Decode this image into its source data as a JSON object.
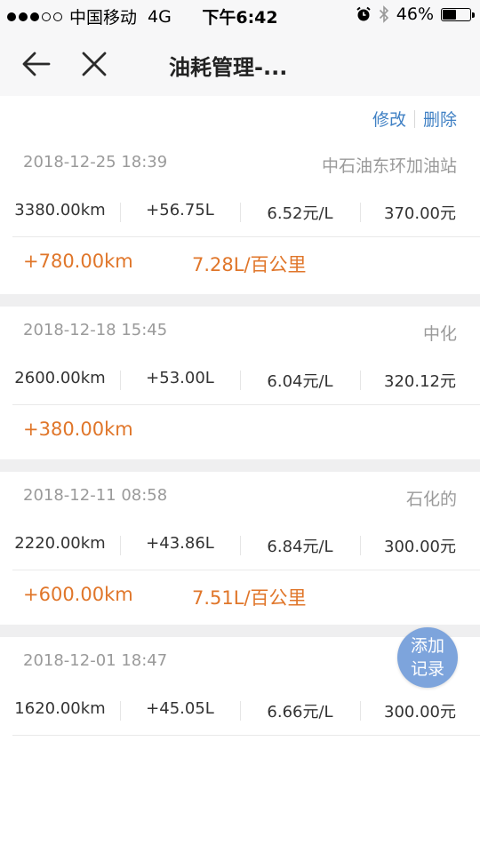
{
  "status": {
    "carrier": "中国移动",
    "network": "4G",
    "time": "下午6:42",
    "battery": "46%",
    "alarm_icon": "alarm-clock-icon",
    "bluetooth_icon": "bluetooth-icon"
  },
  "nav": {
    "title": "油耗管理-...",
    "back_icon": "back-arrow-icon",
    "close_icon": "close-icon"
  },
  "actions": {
    "edit": "修改",
    "delete": "删除"
  },
  "records": [
    {
      "datetime": "2018-12-25 18:39",
      "station": "中石油东环加油站",
      "odometer": "3380.00km",
      "fuel": "+56.75L",
      "price": "6.52元/L",
      "amount": "370.00元",
      "distance": "+780.00km",
      "consumption": "7.28L/百公里"
    },
    {
      "datetime": "2018-12-18 15:45",
      "station": "中化",
      "odometer": "2600.00km",
      "fuel": "+53.00L",
      "price": "6.04元/L",
      "amount": "320.12元",
      "distance": "+380.00km",
      "consumption": ""
    },
    {
      "datetime": "2018-12-11 08:58",
      "station": "石化的",
      "odometer": "2220.00km",
      "fuel": "+43.86L",
      "price": "6.84元/L",
      "amount": "300.00元",
      "distance": "+600.00km",
      "consumption": "7.51L/百公里"
    },
    {
      "datetime": "2018-12-01 18:47",
      "station": "",
      "odometer": "1620.00km",
      "fuel": "+45.05L",
      "price": "6.66元/L",
      "amount": "300.00元",
      "distance": "",
      "consumption": ""
    }
  ],
  "fab": {
    "line1": "添加",
    "line2": "记录"
  },
  "colors": {
    "accent_orange": "#e0762a",
    "link_blue": "#3f80c4",
    "fab_blue": "#7da4dc"
  }
}
